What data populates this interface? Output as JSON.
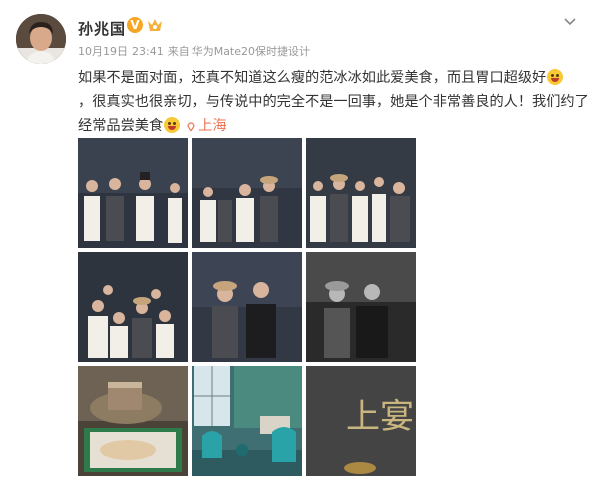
{
  "user": {
    "name": "孙兆国",
    "verified_badge": "V",
    "level_badge_icon": "vip-level-icon"
  },
  "meta": {
    "date": "10月19日",
    "time": "23:41",
    "source_prefix": "来自",
    "source": "华为Mate20保时捷设计"
  },
  "post": {
    "line1": "如果不是面对面，还真不知道这么瘦的范冰冰如此爱美食，而且胃口超级好",
    "line2_a": "，",
    "line2_b": "很真实也很亲切，与传说中的完全不是一回事，她是个非常善良的人！我们约了",
    "line3": "经常品尝美食",
    "location": "上海"
  },
  "photos": [
    {
      "id": "photo-1",
      "icon": "group-photo"
    },
    {
      "id": "photo-2",
      "icon": "group-photo"
    },
    {
      "id": "photo-3",
      "icon": "group-photo"
    },
    {
      "id": "photo-4",
      "icon": "group-photo"
    },
    {
      "id": "photo-5",
      "icon": "duo-photo"
    },
    {
      "id": "photo-6",
      "icon": "duo-photo-bw"
    },
    {
      "id": "photo-7",
      "icon": "food-photo"
    },
    {
      "id": "photo-8",
      "icon": "interior-photo"
    },
    {
      "id": "photo-9",
      "icon": "sign-photo"
    }
  ],
  "sign_text": "上宴",
  "colors": {
    "accent": "#eb7350",
    "badge": "#f6a623",
    "meta_text": "#999999"
  }
}
